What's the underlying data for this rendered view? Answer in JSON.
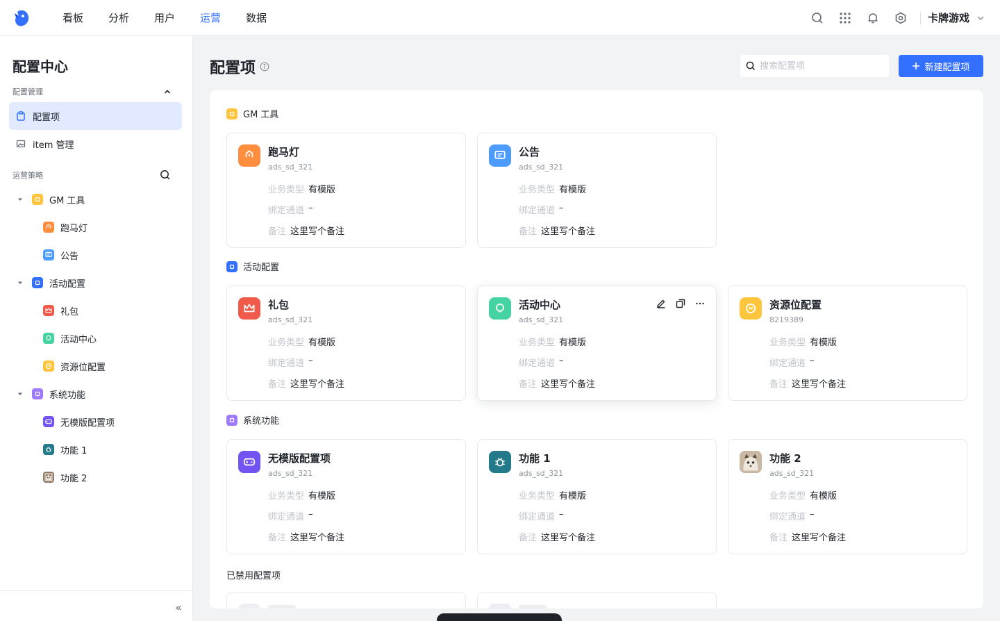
{
  "nav": {
    "items": [
      "看板",
      "分析",
      "用户",
      "运营",
      "数据"
    ],
    "active_index": 3,
    "project": "卡牌游戏"
  },
  "sidebar": {
    "title": "配置中心",
    "section_manage": "配置管理",
    "items": [
      {
        "label": "配置项",
        "active": true
      },
      {
        "label": "item 管理",
        "active": false
      }
    ],
    "section_strategy": "运营策略",
    "tree": [
      {
        "label": "GM 工具",
        "level": 0,
        "color": "#ffc53d"
      },
      {
        "label": "跑马灯",
        "level": 1,
        "color": "#ff8f3f"
      },
      {
        "label": "公告",
        "level": 1,
        "color": "#4e9bff"
      },
      {
        "label": "活动配置",
        "level": 0,
        "color": "#3370ff"
      },
      {
        "label": "礼包",
        "level": 1,
        "color": "#f05a4a"
      },
      {
        "label": "活动中心",
        "level": 1,
        "color": "#45d4a1"
      },
      {
        "label": "资源位配置",
        "level": 1,
        "color": "#ffc53d"
      },
      {
        "label": "系统功能",
        "level": 0,
        "color": "#9f7aff"
      },
      {
        "label": "无模版配置项",
        "level": 1,
        "color": "#7254f2"
      },
      {
        "label": "功能 1",
        "level": 1,
        "color": "#237a8a"
      },
      {
        "label": "功能 2",
        "level": 1,
        "color": "#8a7a6a"
      }
    ],
    "collapse_glyph": "«"
  },
  "main": {
    "title": "配置项",
    "search_placeholder": "搜索配置项",
    "new_button": "新建配置项",
    "field_labels": {
      "type": "业务类型",
      "channel": "绑定通道",
      "note": "备注"
    },
    "groups": [
      {
        "name": "GM 工具",
        "color": "#ffc53d",
        "cards": [
          {
            "title": "跑马灯",
            "id": "ads_sd_321",
            "type": "有模版",
            "channel": "–",
            "note": "这里写个备注",
            "color": "#ff8f3f",
            "icon": "marquee-icon"
          },
          {
            "title": "公告",
            "id": "ads_sd_321",
            "type": "有模版",
            "channel": "–",
            "note": "这里写个备注",
            "color": "#4e9bff",
            "icon": "announcement-icon"
          }
        ]
      },
      {
        "name": "活动配置",
        "color": "#3370ff",
        "cards": [
          {
            "title": "礼包",
            "id": "ads_sd_321",
            "type": "有模版",
            "channel": "–",
            "note": "这里写个备注",
            "color": "#f05a4a",
            "icon": "crown-icon"
          },
          {
            "title": "活动中心",
            "id": "ads_sd_321",
            "type": "有模版",
            "channel": "–",
            "note": "这里写个备注",
            "color": "#45d4a1",
            "icon": "bulb-icon"
          },
          {
            "title": "资源位配置",
            "id": "8219389",
            "type": "有模版",
            "channel": "–",
            "note": "这里写个备注",
            "color": "#ffc53d",
            "icon": "resource-icon"
          }
        ]
      },
      {
        "name": "系统功能",
        "color": "#9f7aff",
        "cards": [
          {
            "title": "无模版配置项",
            "id": "ads_sd_321",
            "type": "有模版",
            "channel": "–",
            "note": "这里写个备注",
            "color": "#7254f2",
            "icon": "gamepad-icon"
          },
          {
            "title": "功能 1",
            "id": "ads_sd_321",
            "type": "有模版",
            "channel": "–",
            "note": "这里写个备注",
            "color": "#237a8a",
            "icon": "bug-icon"
          },
          {
            "title": "功能 2",
            "id": "ads_sd_321",
            "type": "有模版",
            "channel": "–",
            "note": "这里写个备注",
            "color": "#8a7a6a",
            "icon": "cat-avatar-icon"
          }
        ]
      }
    ],
    "disabled_section": "已禁用配置项"
  }
}
